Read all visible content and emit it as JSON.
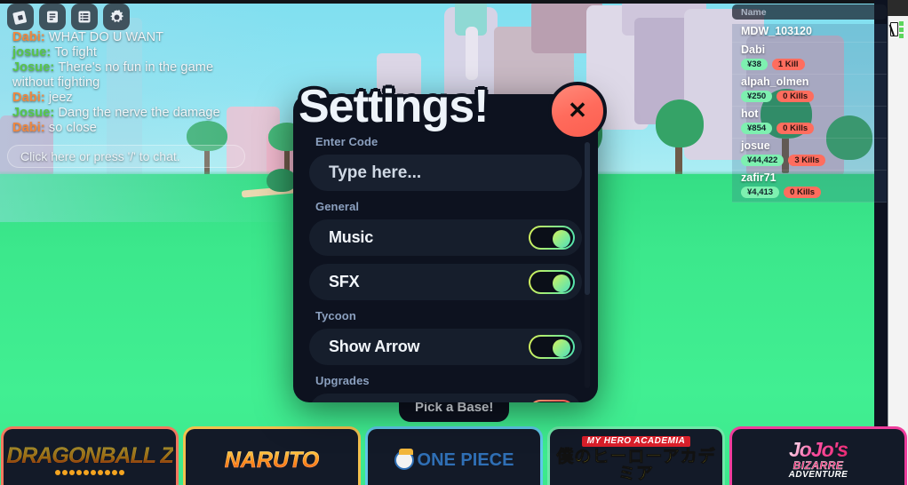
{
  "toolbar": {
    "buttons": [
      {
        "name": "roblox-logo-button",
        "icon": "roblox-logo-icon",
        "label": "Roblox Menu"
      },
      {
        "name": "chat-button",
        "icon": "chat-document-icon",
        "label": "Chat"
      },
      {
        "name": "players-list-button",
        "icon": "list-icon",
        "label": "Players"
      },
      {
        "name": "settings-button",
        "icon": "gear-icon",
        "label": "Settings"
      }
    ]
  },
  "chat": {
    "messages": [
      {
        "speaker": "Dabi",
        "speaker_color": "#f0873f",
        "text": "WHAT DO U WANT"
      },
      {
        "speaker": "josue",
        "speaker_color": "#58c54a",
        "text": "To fight"
      },
      {
        "speaker": "Josue",
        "speaker_color": "#58c54a",
        "text": "There's no fun in the game without fighting"
      },
      {
        "speaker": "Dabi",
        "speaker_color": "#f0873f",
        "text": "jeez"
      },
      {
        "speaker": "Josue",
        "speaker_color": "#58c54a",
        "text": "Dang the nerve the damage"
      },
      {
        "speaker": "Dabi",
        "speaker_color": "#f0873f",
        "text": "so close"
      }
    ],
    "input_prompt": "Click here or press '/' to chat."
  },
  "leaderboard": {
    "header": "Name",
    "rows": [
      {
        "name": "MDW_103120",
        "cash": "",
        "kills": ""
      },
      {
        "name": "Dabi",
        "cash": "¥38",
        "kills": "1 Kill"
      },
      {
        "name": "alpah_olmen",
        "cash": "¥250",
        "kills": "0 Kills"
      },
      {
        "name": "hot",
        "cash": "¥854",
        "kills": "0 Kills"
      },
      {
        "name": "josue",
        "cash": "¥44,422",
        "kills": "3 Kills"
      },
      {
        "name": "zafir71",
        "cash": "¥4,413",
        "kills": "0 Kills"
      }
    ],
    "cash_color": "#7ef0b0",
    "kills_color": "#ff6d5e"
  },
  "settings": {
    "title": "Settings!",
    "close_label": "✕",
    "sections": [
      {
        "label": "Enter Code",
        "type": "input",
        "input": {
          "placeholder": "Type here...",
          "value": ""
        }
      },
      {
        "label": "General",
        "type": "toggles",
        "items": [
          {
            "label": "Music",
            "state": "on"
          },
          {
            "label": "SFX",
            "state": "on"
          }
        ]
      },
      {
        "label": "Tycoon",
        "type": "toggles",
        "items": [
          {
            "label": "Show Arrow",
            "state": "on"
          }
        ]
      },
      {
        "label": "Upgrades",
        "type": "toggles",
        "items": [
          {
            "label": "",
            "state": "off"
          }
        ]
      }
    ]
  },
  "pick_base": {
    "label": "Pick a Base!"
  },
  "base_cards": [
    {
      "name": "Dragon Ball Z",
      "border": "#f2785e",
      "logo_type": "dbz",
      "text": "DRAGONBALL Z"
    },
    {
      "name": "Naruto",
      "border": "#f2c14e",
      "logo_type": "naruto",
      "text": "NARUTO"
    },
    {
      "name": "One Piece",
      "border": "#5ec8e8",
      "logo_type": "onepiece",
      "text": "ONE PIECE"
    },
    {
      "name": "My Hero Academia",
      "border": "#6ee8a8",
      "logo_type": "mha",
      "text_top": "MY HERO ACADEMIA",
      "text_bottom": "僕のヒーローアカデミア"
    },
    {
      "name": "JoJo's Bizarre Adventure",
      "border": "#ef3d9c",
      "logo_type": "jojo",
      "text_1": "JoJo's",
      "text_2": "BIZARRE",
      "text_3": "ADVENTURE"
    }
  ],
  "colors": {
    "dialog_bg": "#0d121f",
    "row_bg": "#161e2c",
    "accent_green": "#4fe3b0",
    "accent_red": "#ff6b5c",
    "section_label": "#8ba0bf",
    "sky": "#8fe4f2",
    "grass": "#3ce88c"
  }
}
